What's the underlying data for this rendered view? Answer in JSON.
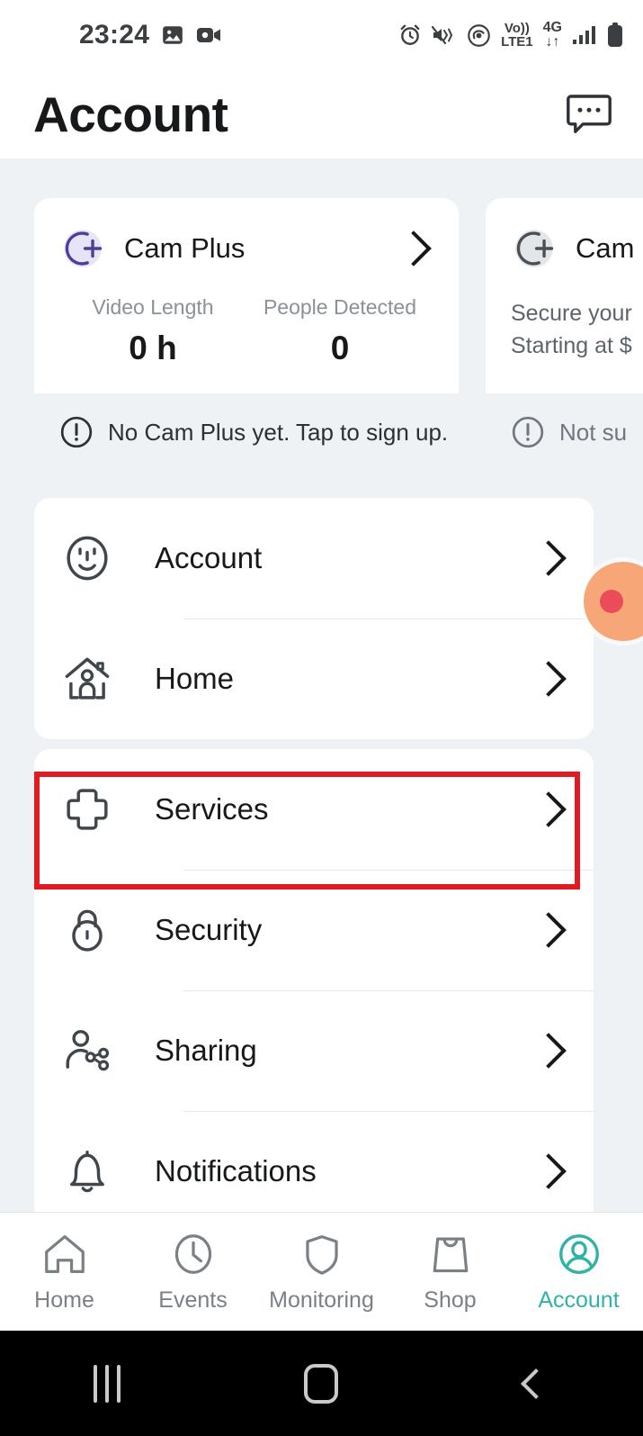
{
  "status_bar": {
    "time": "23:24",
    "left_icons": [
      "gallery-icon",
      "video-camera-icon"
    ],
    "right_icons": [
      "alarm-icon",
      "vibrate-mute-icon",
      "hotspot-icon",
      "volte-icon",
      "4g-icon",
      "signal-icon",
      "battery-icon"
    ],
    "volte_line1": "Vo))",
    "volte_line2": "LTE1",
    "network_gen": "4G",
    "data_arrows": "↓↑"
  },
  "header": {
    "title": "Account",
    "action_icon": "chat-bubble-icon"
  },
  "cam_plus_cards": [
    {
      "icon": "cam-plus-logo-icon",
      "icon_color": "#4b3f9e",
      "icon_bg": "#e8e4f7",
      "name": "Cam Plus",
      "stats": [
        {
          "label": "Video Length",
          "value": "0 h"
        },
        {
          "label": "People Detected",
          "value": "0"
        }
      ],
      "footer_text": "No Cam Plus yet. Tap to sign up.",
      "footer_muted": false
    },
    {
      "icon": "cam-plus-logo-icon",
      "icon_color": "#4b5055",
      "icon_bg": "#e3e6e9",
      "name": "Cam",
      "desc_line1": "Secure your",
      "desc_line2": "Starting at $",
      "footer_text": "Not su",
      "footer_muted": true
    }
  ],
  "menu_group_1": [
    {
      "label": "Account",
      "icon": "smiley-face-icon"
    },
    {
      "label": "Home",
      "icon": "home-person-icon"
    }
  ],
  "menu_group_2": [
    {
      "label": "Services",
      "icon": "plus-cross-icon",
      "highlighted": true
    },
    {
      "label": "Security",
      "icon": "padlock-icon"
    },
    {
      "label": "Sharing",
      "icon": "person-share-icon"
    },
    {
      "label": "Notifications",
      "icon": "bell-icon"
    }
  ],
  "highlight": {
    "color": "#e01b24",
    "target": "Services"
  },
  "floating_bubble": {
    "bg_color": "#f7a777",
    "dot_color": "#ec4b5a"
  },
  "bottom_nav": {
    "active_color": "#2eb3a6",
    "items": [
      {
        "label": "Home",
        "icon": "home-icon",
        "active": false
      },
      {
        "label": "Events",
        "icon": "clock-icon",
        "active": false
      },
      {
        "label": "Monitoring",
        "icon": "shield-icon",
        "active": false
      },
      {
        "label": "Shop",
        "icon": "shopping-bag-icon",
        "active": false
      },
      {
        "label": "Account",
        "icon": "user-circle-icon",
        "active": true
      }
    ]
  },
  "android_nav": {
    "recents": "recents-icon",
    "home": "home-square-icon",
    "back": "back-chevron-icon"
  }
}
